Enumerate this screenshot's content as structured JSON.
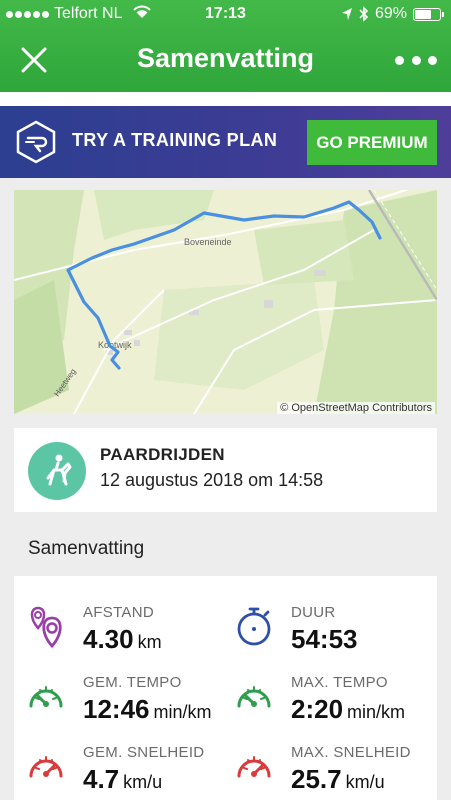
{
  "status_bar": {
    "carrier": "Telfort NL",
    "time": "17:13",
    "battery": "69%",
    "battery_level": 0.69
  },
  "nav": {
    "title": "Samenvatting"
  },
  "banner": {
    "text": "TRY A TRAINING PLAN",
    "button_label": "GO PREMIUM"
  },
  "map": {
    "place_labels": [
      "Boveneinde",
      "Kootwijk",
      "Heetweg"
    ],
    "attribution": "© OpenStreetMap Contributors",
    "route_color": "#4a90e2"
  },
  "activity": {
    "name": "PAARDRIJDEN",
    "date": "12 augustus 2018 om 14:58",
    "icon": "horse-riding-icon",
    "icon_color": "#5cc6a4"
  },
  "summary": {
    "section_title": "Samenvatting",
    "stats": [
      {
        "label": "AFSTAND",
        "value": "4.30",
        "unit": "km",
        "icon": "distance-pin-icon",
        "color": "#9b3fa8"
      },
      {
        "label": "DUUR",
        "value": "54:53",
        "unit": "",
        "icon": "stopwatch-icon",
        "color": "#2e4fa8"
      },
      {
        "label": "GEM. TEMPO",
        "value": "12:46",
        "unit": "min/km",
        "icon": "speedometer-icon",
        "color": "#2e9e4e"
      },
      {
        "label": "MAX. TEMPO",
        "value": "2:20",
        "unit": "min/km",
        "icon": "speedometer-icon",
        "color": "#2e9e4e"
      },
      {
        "label": "GEM. SNELHEID",
        "value": "4.7",
        "unit": "km/u",
        "icon": "speedometer-icon",
        "color": "#d93a3a"
      },
      {
        "label": "MAX. SNELHEID",
        "value": "25.7",
        "unit": "km/u",
        "icon": "speedometer-icon",
        "color": "#d93a3a"
      }
    ]
  },
  "colors": {
    "header_green": "#3bb143",
    "premium_green": "#3fba3a",
    "banner_blue": "#3c3c94"
  }
}
